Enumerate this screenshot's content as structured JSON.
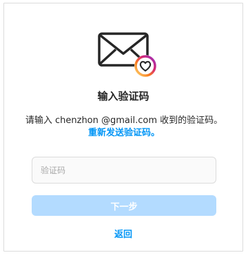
{
  "title": "输入验证码",
  "description": {
    "prefix": "请输入 chenzhon @gmail.com 收到的验证码。",
    "resend_link": "重新发送验证码。"
  },
  "code_input": {
    "placeholder": "验证码",
    "value": ""
  },
  "next_button": {
    "label": "下一步",
    "enabled": false
  },
  "back_link": "返回",
  "colors": {
    "link": "#0095f6",
    "button_disabled": "#b3dbff",
    "border": "#dbdbdb",
    "input_bg": "#fafafa"
  },
  "icons": {
    "envelope": "envelope-icon",
    "badge": "heart-badge-icon"
  }
}
